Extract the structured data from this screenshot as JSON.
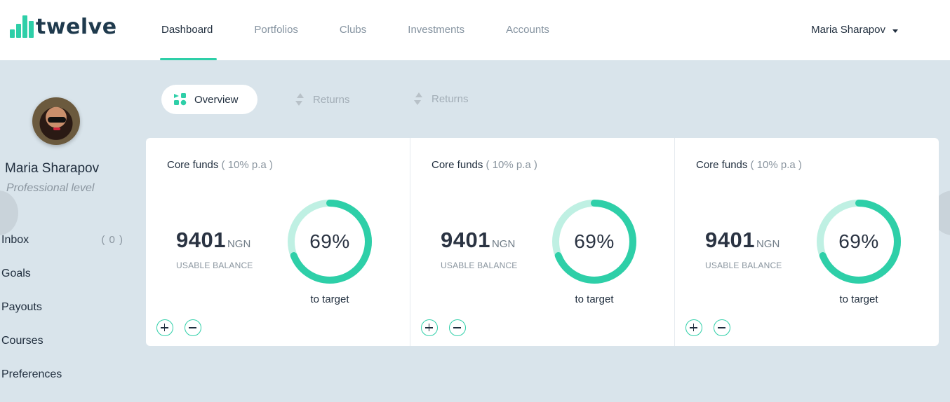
{
  "brand": {
    "name": "twelve",
    "accent": "#2ecfa8"
  },
  "nav": {
    "items": [
      {
        "label": "Dashboard",
        "active": true
      },
      {
        "label": "Portfolios",
        "active": false
      },
      {
        "label": "Clubs",
        "active": false
      },
      {
        "label": "Investments",
        "active": false
      },
      {
        "label": "Accounts",
        "active": false
      }
    ]
  },
  "user": {
    "name": "Maria Sharapov",
    "level": "Professional level"
  },
  "sidebar": {
    "items": [
      {
        "label": "Inbox",
        "count": "( 0 )"
      },
      {
        "label": "Goals"
      },
      {
        "label": "Payouts"
      },
      {
        "label": "Courses"
      },
      {
        "label": "Preferences"
      }
    ]
  },
  "tabs": [
    {
      "label": "Overview",
      "active": true
    },
    {
      "label": "Returns",
      "active": false
    },
    {
      "label": "Returns",
      "active": false
    }
  ],
  "cards": [
    {
      "title": "Core funds",
      "rate": "( 10% p.a )",
      "balance": "9401",
      "currency": "NGN",
      "balance_label": "USABLE BALANCE",
      "progress_percent": 69,
      "progress_text": "69%",
      "progress_label": "to target"
    },
    {
      "title": "Core funds",
      "rate": "( 10% p.a )",
      "balance": "9401",
      "currency": "NGN",
      "balance_label": "USABLE BALANCE",
      "progress_percent": 69,
      "progress_text": "69%",
      "progress_label": "to target"
    },
    {
      "title": "Core funds",
      "rate": "( 10% p.a )",
      "balance": "9401",
      "currency": "NGN",
      "balance_label": "USABLE BALANCE",
      "progress_percent": 69,
      "progress_text": "69%",
      "progress_label": "to target"
    }
  ]
}
